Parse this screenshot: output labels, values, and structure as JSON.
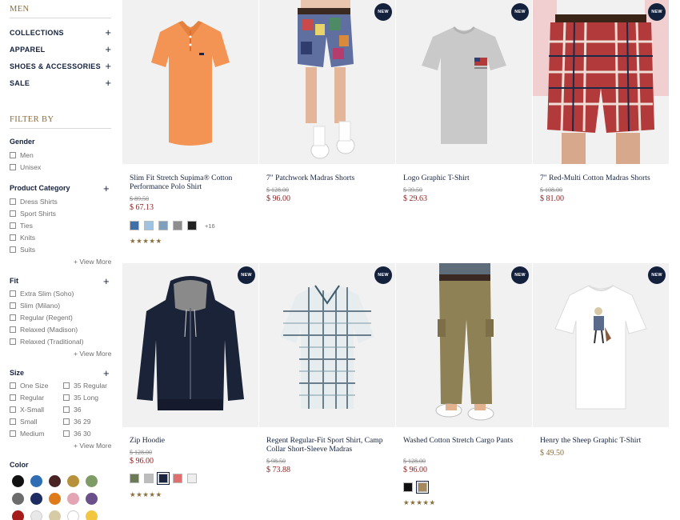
{
  "sidebar": {
    "section_title": "MEN",
    "categories": [
      {
        "label": "COLLECTIONS"
      },
      {
        "label": "APPAREL"
      },
      {
        "label": "SHOES & ACCESSORIES"
      },
      {
        "label": "SALE"
      }
    ],
    "filter_title": "FILTER BY",
    "gender": {
      "title": "Gender",
      "options": [
        "Men",
        "Unisex"
      ]
    },
    "product_category": {
      "title": "Product Category",
      "options": [
        "Dress Shirts",
        "Sport Shirts",
        "Ties",
        "Knits",
        "Suits"
      ],
      "view_more": "+ View More"
    },
    "fit": {
      "title": "Fit",
      "options": [
        "Extra Slim (Soho)",
        "Slim (Milano)",
        "Regular (Regent)",
        "Relaxed (Madison)",
        "Relaxed (Traditional)"
      ],
      "view_more": "+ View More"
    },
    "size": {
      "title": "Size",
      "col1": [
        "One Size",
        "Regular",
        "X-Small",
        "Small",
        "Medium"
      ],
      "col2": [
        "35 Regular",
        "35 Long",
        "36",
        "36 29",
        "36 30"
      ],
      "view_more": "+ View More"
    },
    "color": {
      "title": "Color",
      "swatches": [
        "#111111",
        "#2f6db5",
        "#4a2424",
        "#b8923a",
        "#7f9c68",
        "#6c6c6c",
        "#1d2d62",
        "#e07b1b",
        "#e3a4b4",
        "#6b4f8a",
        "#a51c1c",
        "#e8e8e8",
        "#d7cba6",
        "#ffffff",
        "#f2c641"
      ]
    }
  },
  "products": [
    {
      "name": "Slim Fit Stretch Supima® Cotton Performance Polo Shirt",
      "old_price": "$ 89.50",
      "price": "$ 67.13",
      "is_new": false,
      "swatches": [
        "#3e6fa6",
        "#9fc3e3",
        "#7fa0bd",
        "#8e8e8e",
        "#222222"
      ],
      "more": "+16",
      "rating": "★★★★★"
    },
    {
      "name": "7\" Patchwork Madras Shorts",
      "old_price": "$ 128.00",
      "price": "$ 96.00",
      "is_new": true,
      "badge": "NEW"
    },
    {
      "name": "Logo Graphic T-Shirt",
      "old_price": "$ 39.50",
      "price": "$ 29.63",
      "is_new": true,
      "badge": "NEW"
    },
    {
      "name": "7\" Red-Multi Cotton Madras Shorts",
      "old_price": "$ 108.00",
      "price": "$ 81.00",
      "is_new": true,
      "badge": "NEW"
    },
    {
      "name": "Zip Hoodie",
      "old_price": "$ 128.00",
      "price": "$ 96.00",
      "is_new": true,
      "badge": "NEW",
      "swatches": [
        "#6d7a56",
        "#bdbdbd",
        "#1b2540",
        "#e07070",
        "#eeeeee"
      ],
      "rating": "★★★★★"
    },
    {
      "name": "Regent Regular-Fit Sport Shirt, Camp Collar Short-Sleeve Madras",
      "old_price": "$ 98.50",
      "price": "$ 73.88",
      "is_new": true,
      "badge": "NEW"
    },
    {
      "name": "Washed Cotton Stretch Cargo Pants",
      "old_price": "$ 128.00",
      "price": "$ 96.00",
      "is_new": true,
      "badge": "NEW",
      "swatches": [
        "#111111",
        "#a68a5e"
      ],
      "rating": "★★★★★"
    },
    {
      "name": "Henry the Sheep Graphic T-Shirt",
      "price": "$ 49.50",
      "is_new": true,
      "badge": "NEW"
    }
  ]
}
